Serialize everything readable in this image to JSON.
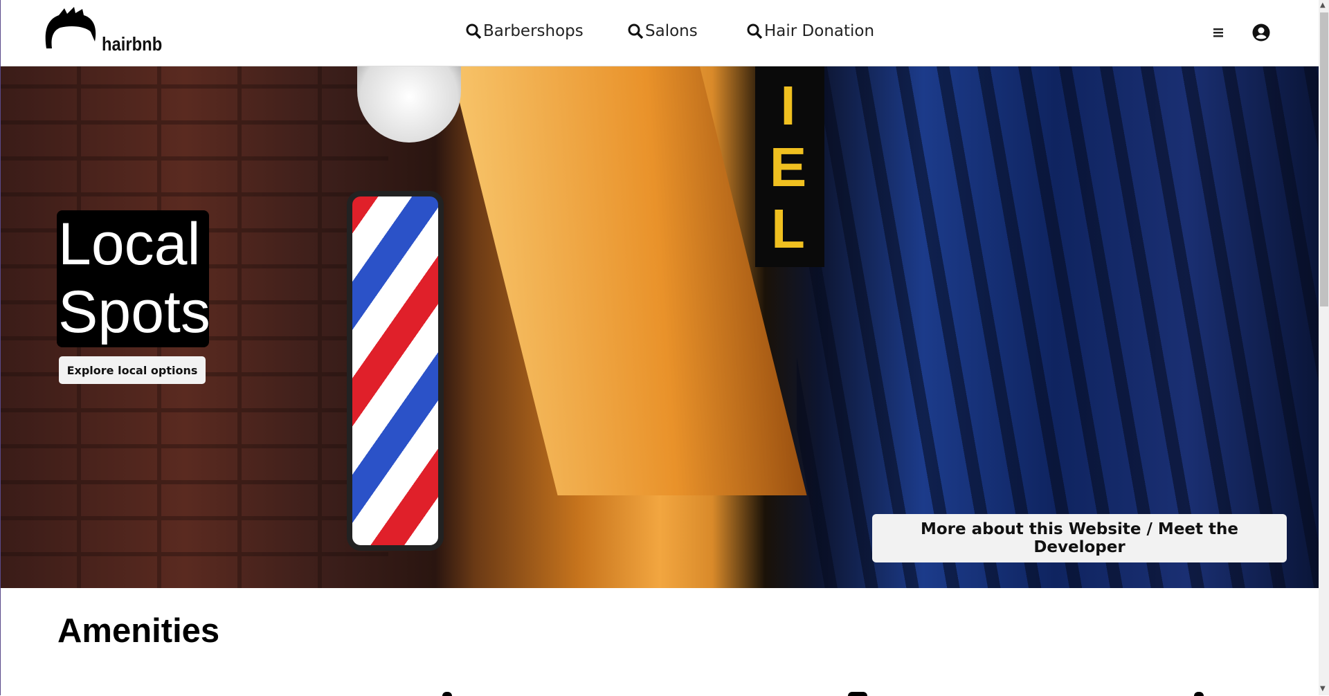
{
  "header": {
    "brand": "hairbnb",
    "nav": [
      {
        "label": "Barbershops",
        "icon": "search-icon"
      },
      {
        "label": "Salons",
        "icon": "search-icon"
      },
      {
        "label": "Hair Donation",
        "icon": "search-icon"
      }
    ],
    "menu_icon": "hamburger-icon",
    "user_icon": "user-circle-icon"
  },
  "hero": {
    "title_line1": "Local",
    "title_line2": "Spots",
    "explore_label": "Explore local options",
    "more_label": "More about this Website / Meet the Developer",
    "sign_letters": "IEL"
  },
  "section": {
    "title": "Amenities"
  }
}
